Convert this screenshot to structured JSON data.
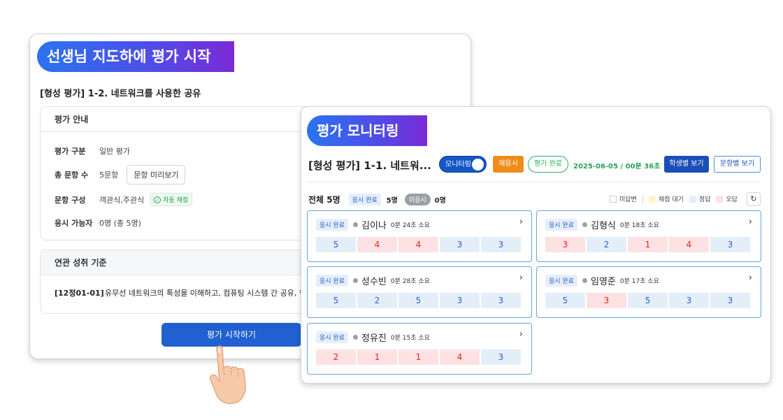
{
  "left_panel": {
    "ribbon": "선생님 지도하에 평가 시작",
    "assessment_title": "[형성 평가] 1-2. 네트워크를 사용한 공유",
    "guide": {
      "heading": "평가 안내",
      "rows": [
        {
          "label": "평가 구분",
          "value": "일반 평가"
        },
        {
          "label": "총 문항 수",
          "value": "5문항",
          "button": "문항 미리보기"
        },
        {
          "label": "문항 구성",
          "value": "객관식,주관식",
          "badge": "자동 채점"
        },
        {
          "label": "응시 가능자",
          "value": "0명 (총 5명)"
        }
      ]
    },
    "standards": {
      "heading": "연관 성취 기준",
      "code": "[12정01-01]",
      "text": "유무선 네트워크의 특성을 이해하고, 컴퓨팅 시스템 간 공유, 협력, 소"
    },
    "start_button": "평가 시작하기"
  },
  "monitor": {
    "ribbon": "평가 모니터링",
    "title": "[형성 평가] 1-1. 네트워...",
    "toggle_label": "모니터링",
    "regrade_button": "재응시",
    "done_button": "평가 완료",
    "date": "2025-06-05 / ",
    "elapsed": "00분 36초",
    "by_student_button": "학생별 보기",
    "by_item_button": "문항별 보기",
    "summary": {
      "total": "전체 5명",
      "done_label": "응시 완료",
      "done_count": "5명",
      "none_label": "미응시",
      "none_count": "0명"
    },
    "legend": [
      {
        "label": "미답변",
        "color": "#ffffff"
      },
      {
        "label": "채점 대기",
        "color": "#fff4cc"
      },
      {
        "label": "정답",
        "color": "#e4eef8"
      },
      {
        "label": "오답",
        "color": "#fde1e3"
      }
    ],
    "students": [
      {
        "status": "응시 완료",
        "name": "김이나",
        "time": "0분 24초 소요",
        "answers": [
          {
            "v": "5",
            "r": "ok"
          },
          {
            "v": "4",
            "r": "bad"
          },
          {
            "v": "4",
            "r": "bad"
          },
          {
            "v": "3",
            "r": "ok"
          },
          {
            "v": "3",
            "r": "ok"
          }
        ]
      },
      {
        "status": "응시 완료",
        "name": "김형식",
        "time": "0분 18초 소요",
        "answers": [
          {
            "v": "3",
            "r": "bad"
          },
          {
            "v": "2",
            "r": "ok"
          },
          {
            "v": "1",
            "r": "bad"
          },
          {
            "v": "4",
            "r": "bad"
          },
          {
            "v": "3",
            "r": "ok"
          }
        ]
      },
      {
        "status": "응시 완료",
        "name": "성수빈",
        "time": "0분 28초 소요",
        "answers": [
          {
            "v": "5",
            "r": "ok"
          },
          {
            "v": "2",
            "r": "ok"
          },
          {
            "v": "5",
            "r": "ok"
          },
          {
            "v": "3",
            "r": "ok"
          },
          {
            "v": "3",
            "r": "ok"
          }
        ]
      },
      {
        "status": "응시 완료",
        "name": "임영준",
        "time": "0분 17초 소요",
        "answers": [
          {
            "v": "5",
            "r": "ok"
          },
          {
            "v": "3",
            "r": "bad"
          },
          {
            "v": "5",
            "r": "ok"
          },
          {
            "v": "3",
            "r": "ok"
          },
          {
            "v": "3",
            "r": "ok"
          }
        ]
      },
      {
        "status": "응시 완료",
        "name": "정유진",
        "time": "0분 15초 소요",
        "answers": [
          {
            "v": "2",
            "r": "bad"
          },
          {
            "v": "1",
            "r": "bad"
          },
          {
            "v": "1",
            "r": "bad"
          },
          {
            "v": "4",
            "r": "bad"
          },
          {
            "v": "3",
            "r": "ok"
          }
        ]
      }
    ]
  }
}
